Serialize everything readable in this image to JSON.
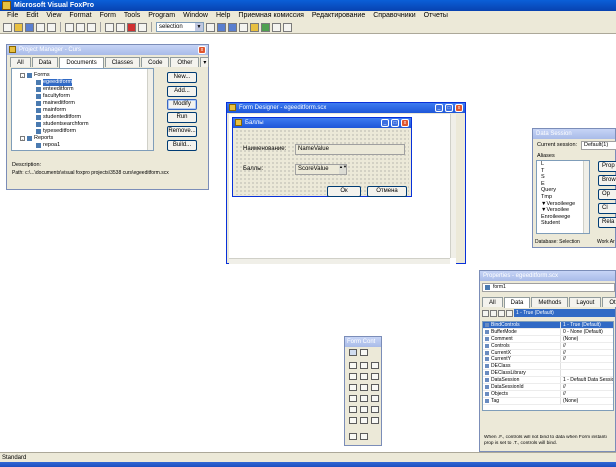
{
  "app": {
    "title": "Microsoft Visual FoxPro",
    "menu": [
      "File",
      "Edit",
      "View",
      "Format",
      "Form",
      "Tools",
      "Program",
      "Window",
      "Help",
      "Приемная комиссия",
      "Редактирование",
      "Справочники",
      "Отчеты"
    ],
    "toolbar_select_value": "selection",
    "status_text": "Standard"
  },
  "project_manager": {
    "title": "Project Manager - Curs",
    "tabs": [
      "All",
      "Data",
      "Documents",
      "Classes",
      "Code",
      "Other"
    ],
    "active_tab": "Documents",
    "tree": {
      "forms_label": "Forms",
      "forms": [
        "egeeditform",
        "enteeditform",
        "facultyform",
        "maineditform",
        "mainform",
        "studenteditform",
        "studentsearchform",
        "typeseditform"
      ],
      "reports_label": "Reports",
      "reports": [
        "repoa1"
      ]
    },
    "buttons": {
      "new": "New...",
      "add": "Add...",
      "modify": "Modify",
      "run": "Run",
      "remove": "Remove...",
      "build": "Build..."
    },
    "description_label": "Description:",
    "path": "Path: c:\\...\\documents\\visual foxpro projects\\3538 curs\\egeeditform.scx"
  },
  "form_designer": {
    "title": "Form Designer - egeeditform.scx",
    "form_caption": "Баллы",
    "label_name": "Наименование:",
    "field_name": "NameValue",
    "label_score": "Баллы:",
    "field_score": "ScoreValue",
    "btn_ok": "Ок",
    "btn_cancel": "Отмена"
  },
  "data_session": {
    "title": "Data Session",
    "current_session_label": "Current session:",
    "current_session_value": "Default(1)",
    "aliases_label": "Aliases",
    "aliases": [
      "L",
      "T",
      "S",
      "E",
      "Query",
      "Tmp",
      "▼Versoileege",
      "▼Versoilee",
      "Enroileeege",
      "Student"
    ],
    "buttons": [
      "Prop",
      "Brow",
      "Op",
      "Cl",
      "Rela"
    ],
    "status_db": "Database: Selection",
    "status_area": "Work Ar"
  },
  "properties": {
    "title": "Properties - egeeditform.scx",
    "object": "form1",
    "tabs": [
      "All",
      "Data",
      "Methods",
      "Layout",
      "Other"
    ],
    "active_tab": "Data",
    "value_box": "1 - True (Default)",
    "rows": [
      {
        "name": "BindControls",
        "value": "1 - True (Default)",
        "selected": true
      },
      {
        "name": "BufferMode",
        "value": "0 - None (Default)"
      },
      {
        "name": "Comment",
        "value": "(None)"
      },
      {
        "name": "Controls",
        "value": "//"
      },
      {
        "name": "CurrentX",
        "value": "//"
      },
      {
        "name": "CurrentY",
        "value": "//"
      },
      {
        "name": "DEClass",
        "value": ""
      },
      {
        "name": "DEClassLibrary",
        "value": ""
      },
      {
        "name": "DataSession",
        "value": "1 - Default Data Session"
      },
      {
        "name": "DataSessionId",
        "value": "//"
      },
      {
        "name": "Objects",
        "value": "//"
      },
      {
        "name": "Tag",
        "value": "(None)"
      }
    ],
    "help_text": "When .F., controls will not bind to data when Form instanti prop is set to .T., controls will bind."
  },
  "form_controls": {
    "title": "Form Cont"
  }
}
